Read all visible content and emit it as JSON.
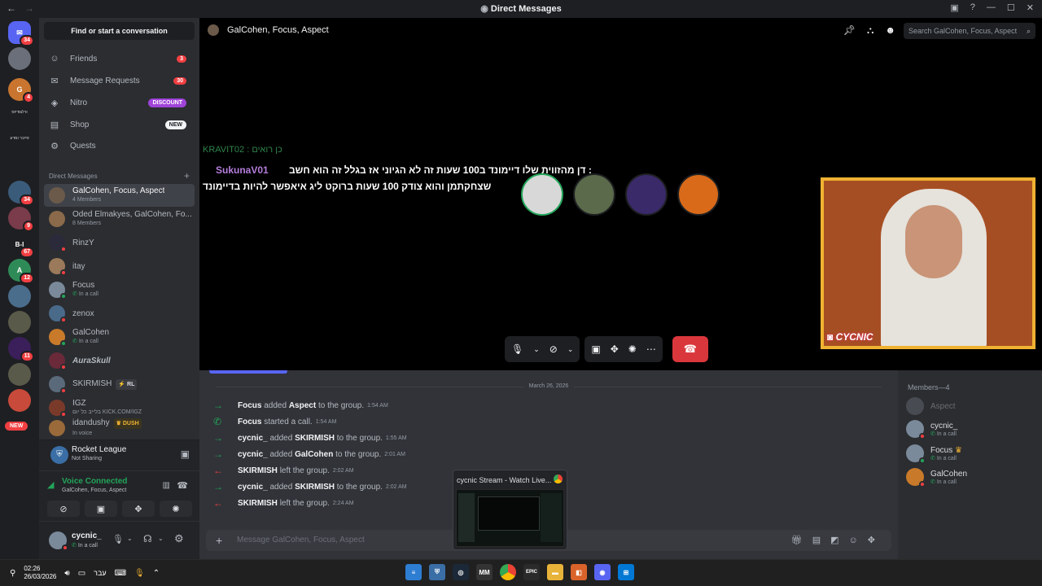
{
  "titlebar": {
    "title": "Direct Messages"
  },
  "rail": {
    "badges": [
      "34",
      "4",
      "34",
      "9",
      "67",
      "12",
      "11"
    ],
    "labels": [
      "ורלצודיוס",
      "סייבר ומדע"
    ],
    "new_label": "NEW"
  },
  "sidebar": {
    "find_label": "Find or start a conversation",
    "nav": [
      {
        "label": "Friends",
        "count": "3"
      },
      {
        "label": "Message Requests",
        "count": "30"
      },
      {
        "label": "Nitro",
        "pill": "DISCOUNT"
      },
      {
        "label": "Shop",
        "pill": "NEW"
      },
      {
        "label": "Quests"
      }
    ],
    "dm_header": "Direct Messages",
    "dms": [
      {
        "name": "GalCohen, Focus, Aspect",
        "sub": "4 Members"
      },
      {
        "name": "Oded Elmakyes, GalCohen, Fo...",
        "sub": "8 Members"
      },
      {
        "name": "RinzY",
        "sub": ""
      },
      {
        "name": "itay",
        "sub": ""
      },
      {
        "name": "Focus",
        "sub": "In a call"
      },
      {
        "name": "zenox",
        "sub": ""
      },
      {
        "name": "GalCohen",
        "sub": "In a call"
      },
      {
        "name": "AuraSkull",
        "sub": ""
      },
      {
        "name": "SKIRMISH",
        "sub": "",
        "tag": "RL"
      },
      {
        "name": "IGZ",
        "sub": "בלייב כל יום KICK.COM/IGZ"
      },
      {
        "name": "idandushy",
        "sub": "In voice",
        "tag": "DUSH"
      }
    ]
  },
  "activity": {
    "title": "Rocket League",
    "sub": "Not Sharing"
  },
  "voice": {
    "status": "Voice Connected",
    "channel": "GalCohen, Focus, Aspect"
  },
  "user": {
    "name": "cycnic_",
    "status": "In a call"
  },
  "call": {
    "title": "GalCohen, Focus, Aspect",
    "search_placeholder": "Search GalCohen, Focus, Aspect"
  },
  "overlay": {
    "line0": "KRAVIT02 : כן רואים",
    "user": "SukunaV01",
    "line1": "דן מהזווית שלו דיימונד ב100 שעות זה לא הגיוני אז בגלל זה הוא חשב :",
    "line2": "שצחקתמן והוא צודק 100 שעות ברוקט ליג איאפשר להיות בדיימונד"
  },
  "webcam": {
    "label": "CYCNIC"
  },
  "chat": {
    "date": "March 26, 2026",
    "messages": [
      {
        "kind": "join",
        "user": "Focus",
        "text": "added",
        "target": "Aspect",
        "rest": "to the group.",
        "time": "1:54 AM"
      },
      {
        "kind": "call",
        "user": "Focus",
        "text": "started a call.",
        "target": "",
        "rest": "",
        "time": "1:54 AM"
      },
      {
        "kind": "join",
        "user": "cycnic_",
        "text": "added",
        "target": "SKIRMISH",
        "rest": "to the group.",
        "time": "1:55 AM"
      },
      {
        "kind": "join",
        "user": "cycnic_",
        "text": "added",
        "target": "GalCohen",
        "rest": "to the group.",
        "time": "2:01 AM"
      },
      {
        "kind": "leave",
        "user": "SKIRMISH",
        "text": "left the group.",
        "target": "",
        "rest": "",
        "time": "2:02 AM"
      },
      {
        "kind": "join",
        "user": "cycnic_",
        "text": "added",
        "target": "SKIRMISH",
        "rest": "to the group.",
        "time": "2:02 AM"
      },
      {
        "kind": "leave",
        "user": "SKIRMISH",
        "text": "left the group.",
        "target": "",
        "rest": "",
        "time": "2:24 AM"
      }
    ],
    "input_placeholder": "Message GalCohen, Focus, Aspect"
  },
  "members": {
    "header": "Members—4",
    "list": [
      {
        "name": "Aspect",
        "sub": ""
      },
      {
        "name": "cycnic_",
        "sub": "In a call"
      },
      {
        "name": "Focus",
        "sub": "In a call"
      },
      {
        "name": "GalCohen",
        "sub": "In a call"
      }
    ]
  },
  "preview": {
    "title": "cycnic Stream - Watch Live..."
  },
  "taskbar": {
    "time": "02:26",
    "date": "26/03/2026",
    "lang": "עבר"
  },
  "colors": {
    "accent": "#5865f2",
    "danger": "#da373c",
    "online": "#23a55a",
    "gold": "#f0b232"
  }
}
